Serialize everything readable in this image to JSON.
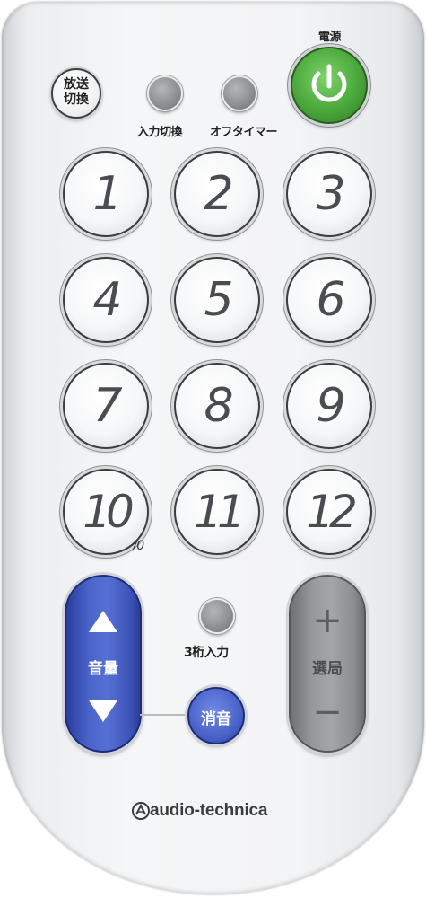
{
  "top": {
    "power_label": "電源",
    "broadcast_switch_label": "放送切換",
    "input_switch_label": "入力切換",
    "off_timer_label": "オフタイマー"
  },
  "keypad": {
    "keys": [
      "1",
      "2",
      "3",
      "4",
      "5",
      "6",
      "7",
      "8",
      "9",
      "10",
      "11",
      "12"
    ],
    "zero_sub_label": "/0"
  },
  "bottom": {
    "volume_label": "音量",
    "three_digit_label": "3桁入力",
    "mute_label": "消音",
    "channel_label": "選局",
    "channel_up": "+",
    "channel_down": "−"
  },
  "brand": {
    "name": "audio-technica"
  },
  "colors": {
    "power_green": "#4aa83a",
    "volume_blue": "#4a63c9",
    "channel_grey": "#96989b"
  },
  "icons": {
    "power": "power-icon",
    "volume_up": "triangle-up-icon",
    "volume_down": "triangle-down-icon",
    "brand_logo": "audio-technica-logo-icon"
  }
}
